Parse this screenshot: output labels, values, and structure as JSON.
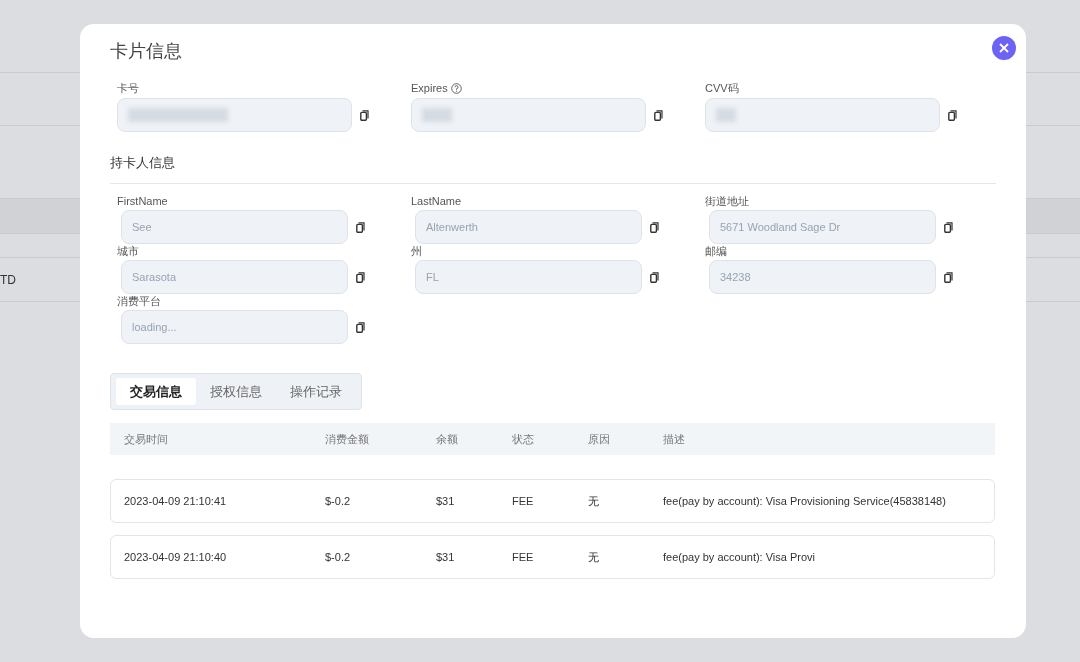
{
  "background": {
    "cell_text": "TD"
  },
  "dialog": {
    "title": "卡片信息",
    "card_fields": [
      {
        "label": "卡号",
        "masked": true,
        "help": false
      },
      {
        "label": "Expires",
        "masked": true,
        "help": true
      },
      {
        "label": "CVV码",
        "masked": true,
        "help": false
      }
    ],
    "holder_section": {
      "title": "持卡人信息",
      "fields": [
        {
          "label": "FirstName",
          "placeholder": "See"
        },
        {
          "label": "LastName",
          "placeholder": "Altenwerth"
        },
        {
          "label": "街道地址",
          "placeholder": "5671 Woodland Sage Dr"
        },
        {
          "label": "城市",
          "placeholder": "Sarasota"
        },
        {
          "label": "州",
          "placeholder": "FL"
        },
        {
          "label": "邮编",
          "placeholder": "34238"
        },
        {
          "label": "消费平台",
          "placeholder": "loading..."
        }
      ]
    },
    "tabs": [
      {
        "label": "交易信息",
        "selected": true
      },
      {
        "label": "授权信息",
        "selected": false
      },
      {
        "label": "操作记录",
        "selected": false
      }
    ],
    "table": {
      "columns": [
        "交易时间",
        "消费金额",
        "余额",
        "状态",
        "原因",
        "描述"
      ],
      "rows": [
        [
          "2023-04-09 21:10:41",
          "$-0.2",
          "$31",
          "FEE",
          "无",
          "fee(pay by account): Visa Provisioning Service(45838148)"
        ],
        [
          "2023-04-09 21:10:40",
          "$-0.2",
          "$31",
          "FEE",
          "无",
          "fee(pay by account): Visa Provi"
        ]
      ]
    }
  }
}
